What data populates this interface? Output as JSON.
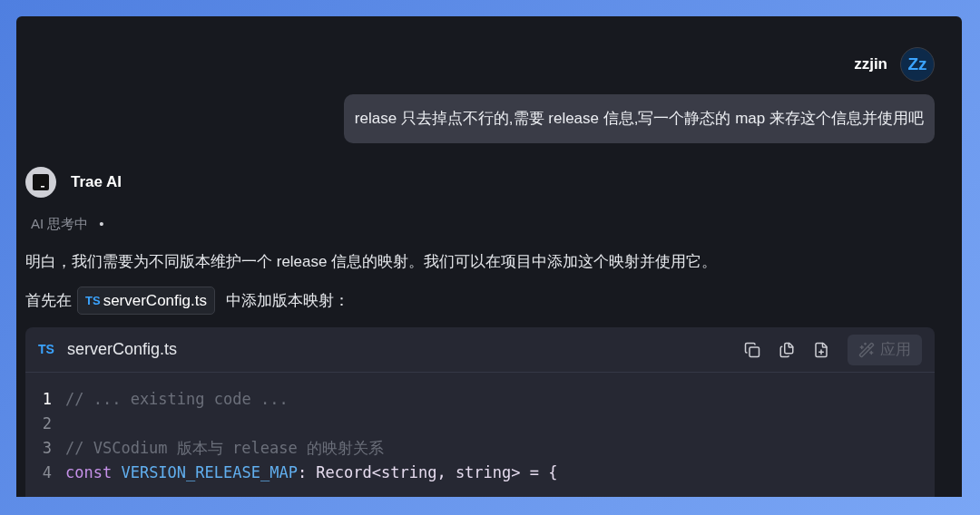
{
  "user": {
    "name": "zzjin",
    "avatar": "Zz",
    "message": "relase 只去掉点不行的,需要 release 信息,写一个静态的 map 来存这个信息并使用吧"
  },
  "assistant": {
    "name": "Trae AI",
    "status": "AI 思考中",
    "status_mark": "•",
    "paragraph": "明白，我们需要为不同版本维护一个 release 信息的映射。我们可以在项目中添加这个映射并使用它。",
    "intro_before": "首先在",
    "file_chip": {
      "lang": "TS",
      "name": "serverConfig.ts"
    },
    "intro_after": "中添加版本映射："
  },
  "code_block": {
    "lang": "TS",
    "filename": "serverConfig.ts",
    "apply": {
      "label": "应用",
      "disabled": true
    },
    "lines": [
      {
        "number": "1",
        "current": true,
        "tokens": [
          {
            "text": "// ... existing code ...",
            "kind": "comment"
          }
        ]
      },
      {
        "number": "2",
        "current": false
      },
      {
        "number": "3",
        "current": false,
        "tokens": [
          {
            "text": "// VSCodium 版本与 release 的映射关系",
            "kind": "comment"
          }
        ]
      },
      {
        "number": "4",
        "current": false,
        "tokens": [
          {
            "text": "const ",
            "kind": "keyword"
          },
          {
            "text": "VERSION_RELEASE_MAP",
            "kind": "constant"
          },
          {
            "text": ": Record<string, string> = {",
            "kind": "plain"
          }
        ]
      }
    ]
  }
}
